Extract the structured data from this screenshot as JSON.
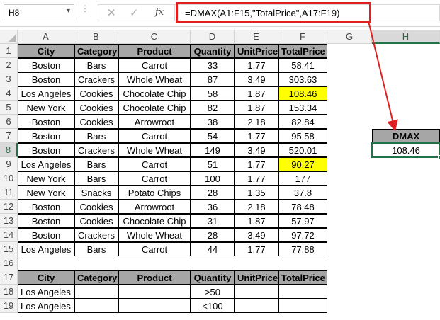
{
  "formula_bar": {
    "name_box": "H8",
    "cancel_icon": "✕",
    "enter_icon": "✓",
    "fx_label": "fx",
    "formula": "=DMAX(A1:F15,\"TotalPrice\",A17:F19)"
  },
  "column_headers": [
    "A",
    "B",
    "C",
    "D",
    "E",
    "F",
    "G",
    "H"
  ],
  "active_column": "H",
  "active_row": "8",
  "row_headers": [
    "1",
    "2",
    "3",
    "4",
    "5",
    "6",
    "7",
    "8",
    "9",
    "10",
    "11",
    "12",
    "13",
    "14",
    "15",
    "16",
    "17",
    "18",
    "19"
  ],
  "table_headers": [
    "City",
    "Category",
    "Product",
    "Quantity",
    "UnitPrice",
    "TotalPrice"
  ],
  "table_rows": [
    [
      "Boston",
      "Bars",
      "Carrot",
      "33",
      "1.77",
      "58.41"
    ],
    [
      "Boston",
      "Crackers",
      "Whole Wheat",
      "87",
      "3.49",
      "303.63"
    ],
    [
      "Los Angeles",
      "Cookies",
      "Chocolate Chip",
      "58",
      "1.87",
      "108.46"
    ],
    [
      "New York",
      "Cookies",
      "Chocolate Chip",
      "82",
      "1.87",
      "153.34"
    ],
    [
      "Boston",
      "Cookies",
      "Arrowroot",
      "38",
      "2.18",
      "82.84"
    ],
    [
      "Boston",
      "Bars",
      "Carrot",
      "54",
      "1.77",
      "95.58"
    ],
    [
      "Boston",
      "Crackers",
      "Whole Wheat",
      "149",
      "3.49",
      "520.01"
    ],
    [
      "Los Angeles",
      "Bars",
      "Carrot",
      "51",
      "1.77",
      "90.27"
    ],
    [
      "New York",
      "Bars",
      "Carrot",
      "100",
      "1.77",
      "177"
    ],
    [
      "New York",
      "Snacks",
      "Potato Chips",
      "28",
      "1.35",
      "37.8"
    ],
    [
      "Boston",
      "Cookies",
      "Arrowroot",
      "36",
      "2.18",
      "78.48"
    ],
    [
      "Boston",
      "Cookies",
      "Chocolate Chip",
      "31",
      "1.87",
      "57.97"
    ],
    [
      "Boston",
      "Crackers",
      "Whole Wheat",
      "28",
      "3.49",
      "97.72"
    ],
    [
      "Los Angeles",
      "Bars",
      "Carrot",
      "44",
      "1.77",
      "77.88"
    ]
  ],
  "highlighted_totals": [
    "108.46",
    "90.27"
  ],
  "criteria_headers": [
    "City",
    "Category",
    "Product",
    "Quantity",
    "UnitPrice",
    "TotalPrice"
  ],
  "criteria_rows": [
    [
      "Los Angeles",
      "",
      "",
      ">50",
      "",
      ""
    ],
    [
      "Los Angeles",
      "",
      "",
      "<100",
      "",
      ""
    ]
  ],
  "dmax": {
    "label": "DMAX",
    "result": "108.46"
  },
  "colors": {
    "header_fill": "#a6a6a6",
    "highlight_fill": "#ffff00",
    "annotation_red": "#e02020",
    "selection_green": "#217346"
  }
}
